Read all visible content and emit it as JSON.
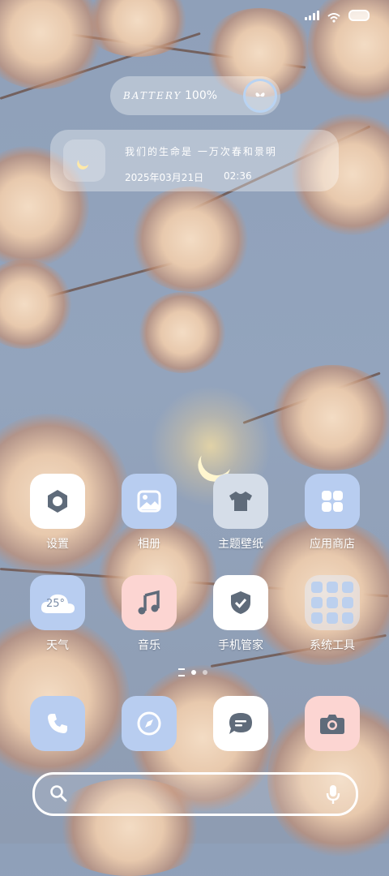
{
  "status": {
    "signal": "signal-icon",
    "wifi": "wifi-icon",
    "battery": "battery-icon"
  },
  "battery_widget": {
    "label": "BATTERY",
    "percent": "100%"
  },
  "quote_widget": {
    "text": "我们的生命是 一万次春和景明",
    "date": "2025年03月21日",
    "time": "02:36"
  },
  "apps": [
    {
      "label": "设置",
      "icon": "settings-icon"
    },
    {
      "label": "相册",
      "icon": "gallery-icon"
    },
    {
      "label": "主题壁纸",
      "icon": "theme-icon"
    },
    {
      "label": "应用商店",
      "icon": "app-store-icon"
    },
    {
      "label": "天气",
      "icon": "weather-icon",
      "temp": "25°"
    },
    {
      "label": "音乐",
      "icon": "music-icon"
    },
    {
      "label": "手机管家",
      "icon": "security-icon"
    },
    {
      "label": "系统工具",
      "icon": "system-tools-folder"
    }
  ],
  "dock": [
    "phone-icon",
    "browser-icon",
    "messages-icon",
    "camera-icon"
  ],
  "search": {
    "icon": "search-icon",
    "mic": "microphone-icon"
  },
  "colors": {
    "blue": "#b8cdf0",
    "pink": "#fcd5d2",
    "icon_dark": "#5f6b7a"
  }
}
